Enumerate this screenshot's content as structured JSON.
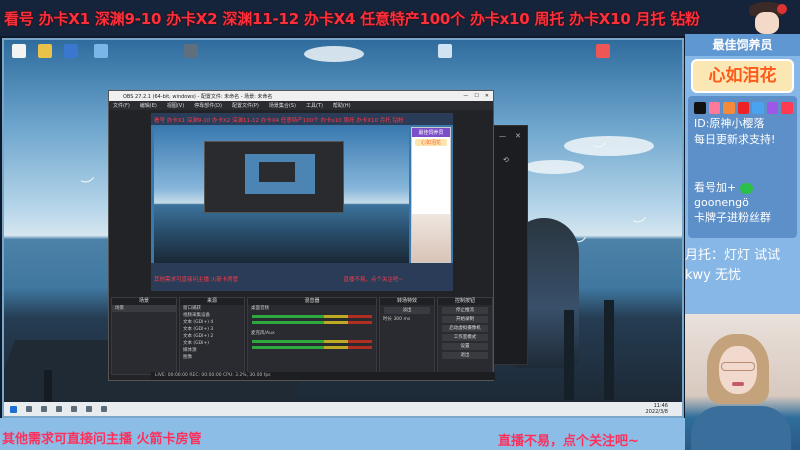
{
  "top_banner": {
    "text": "看号 办卡X1 深渊9-10 办卡X2 深渊11-12 办卡X4 任意特产100个 办卡x10  周托 办卡X10  月托 钻粉"
  },
  "obs": {
    "title": "OBS 27.2.1 (64-bit, windows) - 配置文件: 未命名 - 场景: 未命名",
    "menu": [
      "文件(F)",
      "编辑(E)",
      "视图(V)",
      "停靠部件(D)",
      "配置文件(P)",
      "场景集合(S)",
      "工具(T)",
      "帮助(H)"
    ],
    "preview_banner": "看号 办卡X1 深渊9-10 办卡X2 深渊11-12 办卡X4 任意特产100个 办卡x10  周托 办卡X10  月托 钻粉",
    "preview_sidebar_title": "最佳饲养员",
    "preview_sidebar_box": "心如泪花",
    "preview_bottom_left": "其他需求可直接问主播 火箭卡房管",
    "preview_bottom_right": "直播不易，点个关注吧~",
    "panels": {
      "scenes": "场景",
      "sources": "来源",
      "mixer": "混音器",
      "transitions": "转场特效",
      "controls": "控制按钮"
    },
    "sources": [
      "窗口捕获",
      "视频采集设备",
      "文本 (GDI+) 4",
      "文本 (GDI+) 3",
      "文本 (GDI+) 2",
      "文本 (GDI+)",
      "媒体源",
      "图像"
    ],
    "mixer_tracks": [
      "桌面音频",
      "麦克风/Aux"
    ],
    "transitions_value": "淡出",
    "duration_label": "时长",
    "duration_value": "300 ms",
    "controls": [
      "停止推流",
      "开始录制",
      "启动虚拟摄像机",
      "工作室模式",
      "设置",
      "退出"
    ],
    "status": "LIVE: 00:00:00   REC: 00:00:00   CPU: 3.2%, 30.00 fps"
  },
  "taskbar": {
    "time": "11:46",
    "date": "2022/3/8"
  },
  "right_panel": {
    "header": "最佳饲养员",
    "title_box": "心如泪花",
    "social_id": "ID:原神小樱落",
    "social_update": "每日更新求支持!",
    "contact_line": "看号加+",
    "contact_id": "goonengö",
    "contact_group": "卡牌子进粉丝群",
    "monthly_label": "月托：灯灯 试试",
    "monthly_name": "kwy 无忧"
  },
  "bottom": {
    "left_text": "其他需求可直接问主播 火箭卡房管",
    "right_text": "直播不易，点个关注吧~"
  },
  "colors": {
    "banner_red": "#ff2f3c",
    "panel_blue": "#87b7e6",
    "title_orange": "#ff5a1a",
    "bottom_pink": "#ff2f5c"
  }
}
